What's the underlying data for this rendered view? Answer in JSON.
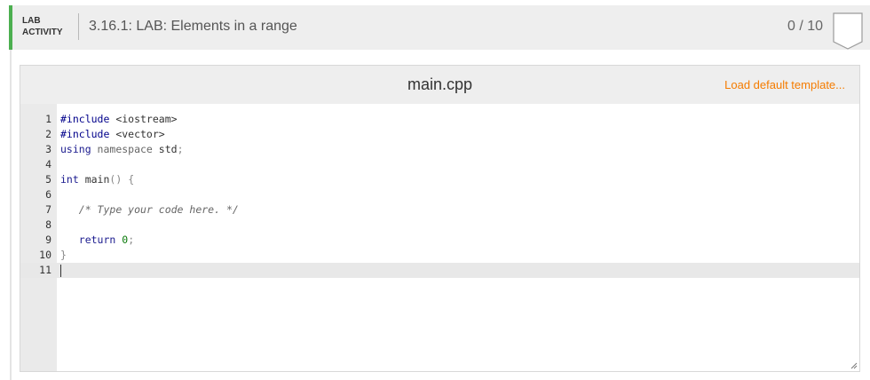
{
  "lab": {
    "tag_line1": "LAB",
    "tag_line2": "ACTIVITY",
    "title": "3.16.1: LAB: Elements in a range",
    "score": "0 / 10",
    "accent_color": "#4caf50"
  },
  "editor": {
    "file_name": "main.cpp",
    "load_template_label": "Load default template...",
    "link_color": "#f57c00",
    "active_line": 11,
    "lines": [
      {
        "num": "1",
        "tokens": [
          {
            "cls": "tok-directive",
            "text": "#include"
          },
          {
            "cls": "tok-include",
            "text": " <iostream>"
          }
        ]
      },
      {
        "num": "2",
        "tokens": [
          {
            "cls": "tok-directive",
            "text": "#include"
          },
          {
            "cls": "tok-include",
            "text": " <vector>"
          }
        ]
      },
      {
        "num": "3",
        "tokens": [
          {
            "cls": "tok-keyword",
            "text": "using"
          },
          {
            "cls": "tok-ns",
            "text": " namespace"
          },
          {
            "cls": "tok-include",
            "text": " std"
          },
          {
            "cls": "tok-paren",
            "text": ";"
          }
        ]
      },
      {
        "num": "4",
        "tokens": []
      },
      {
        "num": "5",
        "tokens": [
          {
            "cls": "tok-type",
            "text": "int"
          },
          {
            "cls": "tok-include",
            "text": " main"
          },
          {
            "cls": "tok-paren",
            "text": "()"
          },
          {
            "cls": "tok-include",
            "text": " "
          },
          {
            "cls": "tok-paren",
            "text": "{"
          }
        ]
      },
      {
        "num": "6",
        "tokens": []
      },
      {
        "num": "7",
        "tokens": [
          {
            "cls": "tok-include",
            "text": "   "
          },
          {
            "cls": "tok-comment",
            "text": "/* Type your code here. */"
          }
        ]
      },
      {
        "num": "8",
        "tokens": []
      },
      {
        "num": "9",
        "tokens": [
          {
            "cls": "tok-include",
            "text": "   "
          },
          {
            "cls": "tok-keyword",
            "text": "return"
          },
          {
            "cls": "tok-include",
            "text": " "
          },
          {
            "cls": "tok-number",
            "text": "0"
          },
          {
            "cls": "tok-paren",
            "text": ";"
          }
        ]
      },
      {
        "num": "10",
        "tokens": [
          {
            "cls": "tok-paren",
            "text": "}"
          }
        ]
      },
      {
        "num": "11",
        "tokens": []
      }
    ]
  },
  "icons": {
    "score_badge": "shield-badge-icon",
    "resize": "resize-grip-icon"
  }
}
